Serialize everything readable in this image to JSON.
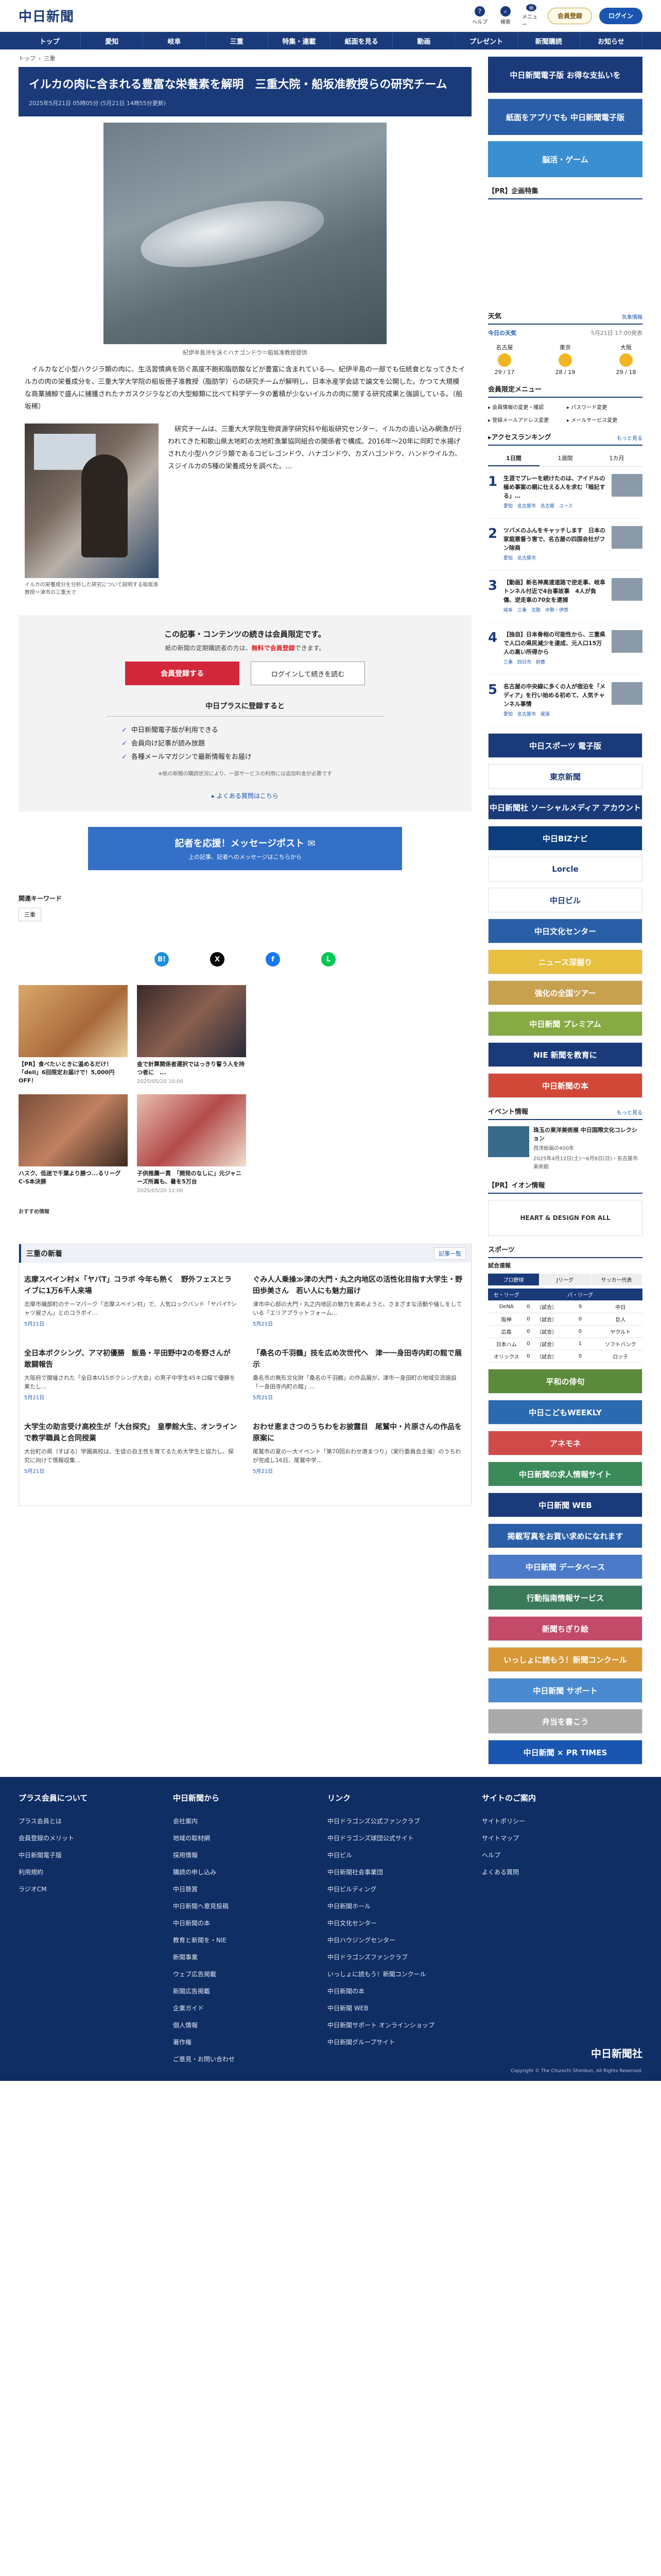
{
  "header": {
    "logo": "中日新聞",
    "icons": [
      {
        "label": "ヘルプ",
        "glyph": "?"
      },
      {
        "label": "検索",
        "glyph": "⌕"
      },
      {
        "label": "メニュー",
        "glyph": "≡"
      }
    ],
    "register": "会員登録",
    "login": "ログイン"
  },
  "nav": [
    "トップ",
    "愛知",
    "岐阜",
    "三重",
    "特集・連載",
    "紙面を見る",
    "動画",
    "プレゼント",
    "新聞購読",
    "お知らせ"
  ],
  "breadcrumb": [
    "トップ",
    "三重"
  ],
  "article": {
    "title": "イルカの肉に含まれる豊富な栄養素を解明　三重大院・船坂准教授らの研究チーム",
    "date": "2025年5月21日 05時05分 (5月21日 14時55分更新)",
    "photo_caption": "紀伊半島沖を泳ぐハナゴンドウ＝船坂准教授提供",
    "lead": "イルカなど小型ハクジラ類の肉に、生活習慣病を防ぐ高度不飽和脂肪酸などが豊富に含まれている―。紀伊半島の一部でも伝統食となってきたイルカの肉の栄養成分を、三重大学大学院の船坂徳子准教授（脂肪学）らの研究チームが解明し、日本水産学会誌で論文を公開した。かつて大規模な商業捕鯨で盛んに捕獲されたナガスクジラなどの大型鯨類に比べて科学データの蓄積が少ないイルカの肉に関する研究成果と強調している。（船坂稀）",
    "second_caption": "イルカの栄養成分を分析した研究について説明する船坂准教授＝津市の三重大で",
    "second_text": "研究チームは、三重大大学院生物資源学研究科や船坂研究センター、イルカの追い込み網漁が行われてきた和歌山県太地町の太地町漁業協同組合の関係者で構成。2016年〜20年に同町で水揚げされた小型ハクジラ類であるコビレゴンドウ、ハナゴンドウ、カズハゴンドウ、ハンドウイルカ、スジイルカの5種の栄養成分を調べた。..."
  },
  "paywall": {
    "title": "この記事・コンテンツの続きは会員限定です。",
    "sub_prefix": "紙の新聞の定期購読者の方は、",
    "sub_emph": "無料で会員登録",
    "sub_suffix": "できます。",
    "register_btn": "会員登録する",
    "login_btn": "ログインして続きを読む",
    "plus_title": "中日プラスに登録すると",
    "benefits": [
      "中日新聞電子版が利用できる",
      "会員向け記事が読み放題",
      "各種メールマガジンで最新情報をお届け"
    ],
    "note": "※紙の新聞の購読状況により、一部サービスの利用には追加料金が必要です",
    "faq": "よくある質問はこちら"
  },
  "message_post": {
    "title": "記者を応援！メッセージポスト",
    "sub": "上の記事、記者へのメッセージはこちらから"
  },
  "keywords": {
    "heading": "関連キーワード",
    "tags": [
      "三重"
    ]
  },
  "share": [
    "B!",
    "X",
    "f",
    "L"
  ],
  "related": [
    {
      "title": "【PR】食べたいときに温めるだけ！「deli」6回限定お届けで！5,000円OFF！",
      "date": "",
      "color": "#c89058"
    },
    {
      "title": "金で計算関係者選択ではっきり誓う人を持つ者に　...",
      "date": "2025/05/20 10:00",
      "color": "#5a3a3a"
    },
    {
      "title": "ハスク、低迷で千葉より勝つ...るリーグ C-S本決勝",
      "date": "",
      "color": "#7a4e3a"
    },
    {
      "title": "子供推薦一貫　「開発のなしに」元ジャニーズ所属も、暑を5万台",
      "date": "2025/05/20 11:00",
      "color": "#b44a4a"
    }
  ],
  "osusume": "おすすめ情報",
  "news": {
    "heading": "三重の新着",
    "more": "記事一覧",
    "items": [
      {
        "title": "志摩スペイン村×「ヤバT」コラボ 今年も熱く　野外フェスとライブに1万6千人来場",
        "snippet": "志摩市磯部町のテーマパーク「志摩スペイン村」で、人気ロックバンド「ヤバイTシャツ屋さん」とのコラボイ...",
        "date": "5月21日"
      },
      {
        "title": "ぐみ人人乗操≫津の大門・丸之内地区の活性化目指す大学生・野田歩美さん　若い人にも魅力届け",
        "snippet": "津市中心部の大門・丸之内地区の魅力を高めようと、さまざまな活動や催しをしている「エリアプラットフォーム...",
        "date": "5月21日"
      },
      {
        "title": "全日本ボクシング、アマ初優勝　飯島・平田野中2の冬野さんが敢闘報告",
        "snippet": "大阪府で開催された「全日本U15ボクシング大会」の男子中学生45キロ級で優勝を果たし...",
        "date": "5月21日"
      },
      {
        "title": "「桑名の千羽鶴」技を広め次世代へ　津一一身田寺内町の館で展示",
        "snippet": "桑名市の無形文化財「桑名の千羽鶴」の作品展が、津市一身田町の地域交流施設「一身田寺内町の館」...",
        "date": "5月21日"
      },
      {
        "title": "大学生の助言受け高校生が「大台探究」　皇學館大生、オンラインで教学職員と合同授業",
        "snippet": "大台町の県（すばる）学園高校は、生徒の自主性を育てるため大学生と協力し、探究に向けて情報収集...",
        "date": "5月21日"
      },
      {
        "title": "おわせ恵まさつのうちわをお披露目　尾鷲中・片原さんの作品を原案に",
        "snippet": "尾鷲市の夏の一大イベント「第70回おわせ港まつり」（実行委員会主催）のうちわが完成し16日、尾鷲中学...",
        "date": "5月21日"
      }
    ]
  },
  "sidebar": {
    "banners": [
      {
        "text": "中日新聞電子版 お得な支払いを",
        "color": "#1a3a7a"
      },
      {
        "text": "紙面をアプリでも 中日新聞電子版",
        "color": "#2a5fa8"
      },
      {
        "text": "脳活・ゲーム",
        "color": "#3a8fd0"
      }
    ],
    "pr_heading": "【PR】企画特集",
    "weather": {
      "heading": "天気",
      "more": "気象情報",
      "cities": [
        {
          "name": "名古屋",
          "temp": "29 / 17"
        },
        {
          "name": "東京",
          "temp": "28 / 19"
        },
        {
          "name": "大阪",
          "temp": "29 / 18"
        }
      ],
      "today": "今日の天気",
      "updated": "5月21日 17:00発表"
    },
    "menu": {
      "heading": "会員限定メニュー",
      "items": [
        "会員情報の変更・確認",
        "パスワード変更",
        "登録メールアドレス変更",
        "メールサービス変更"
      ]
    },
    "ranking": {
      "heading": "アクセスランキング",
      "more": "もっと見る",
      "tabs": [
        "1日間",
        "1週間",
        "1カ月"
      ],
      "items": [
        {
          "rank": "1",
          "title": "生涯でプレーを続けたのは、アイドルの極め事案の親に仕える人を求む「暗記する」…",
          "tags": "愛知　名古屋市　名古屋　ユース"
        },
        {
          "rank": "2",
          "title": "ツバメのふんをキャッチします　日本の家庭悪督う害で、名古屋の四国会社がフン除商",
          "tags": "愛知　名古屋市"
        },
        {
          "rank": "3",
          "title": "【動画】新名神高速道路で逆走事、岐阜トンネル付近で4台事故事　4人が負傷、逆走車の70女を逮捕",
          "tags": "岐阜　三重　北勢　中勢・伊賀"
        },
        {
          "rank": "4",
          "title": "【独自】日本骨相の可能性から、三重県で人口の県民減少を達成、元人口15万人の高い所得から",
          "tags": "三重　四日市　鈴鹿"
        },
        {
          "rank": "5",
          "title": "名古屋の中央線に多くの人が宿泊を「メディア」を行い始める初めて、人気チャンネル事情",
          "tags": "愛知　名古屋市　尾張"
        }
      ]
    },
    "ad_banners": [
      {
        "text": "中日スポーツ 電子版",
        "color": "#1a3a7a"
      },
      {
        "text": "東京新聞",
        "color": "#ffffff"
      },
      {
        "text": "中日新聞社 ソーシャルメディア アカウント",
        "color": "#1a3a7a"
      },
      {
        "text": "中日BIZナビ",
        "color": "#0c3d7c"
      },
      {
        "text": "Lorcle",
        "color": "#ffffff"
      },
      {
        "text": "中日ビル",
        "color": "#ffffff"
      },
      {
        "text": "中日文化センター",
        "color": "#2a5fa8"
      },
      {
        "text": "ニュース深掘り",
        "color": "#e8c040"
      },
      {
        "text": "強化の全国ツアー",
        "color": "#c7a050"
      },
      {
        "text": "中日新聞 プレミアム",
        "color": "#88aa44"
      },
      {
        "text": "NIE 新聞を教育に",
        "color": "#1a3a7a"
      },
      {
        "text": "中日新聞の本",
        "color": "#d24838"
      }
    ],
    "event": {
      "heading": "イベント情報",
      "more": "もっと見る",
      "title": "珠玉の東洋美術展 中日国際文化コレクション",
      "place": "西洋絵画の400年",
      "date": "2025年4月12日(土)〜6月8日(日)・名古屋市美術館"
    },
    "pr2_heading": "【PR】イオン情報",
    "heart": "HEART & DESIGN FOR ALL",
    "sports": {
      "heading": "スポーツ",
      "sub": "試合速報",
      "tabs": [
        "プロ野球",
        "Jリーグ",
        "サッカー代表"
      ],
      "cols": [
        "セ・リーグ",
        "",
        "",
        "パ・リーグ",
        ""
      ],
      "rows": [
        [
          "DeNA",
          "0",
          "（試合）",
          "9",
          "中日"
        ],
        [
          "阪神",
          "0",
          "（試合）",
          "0",
          "巨人"
        ],
        [
          "広島",
          "0",
          "（試合）",
          "0",
          "ヤクルト"
        ],
        [
          "日本ハム",
          "0",
          "（試合）",
          "1",
          "ソフトバンク"
        ],
        [
          "オリックス",
          "0",
          "（試合）",
          "0",
          "ロッテ"
        ]
      ]
    },
    "bottom_banners": [
      {
        "text": "平和の俳句",
        "color": "#5a8a3a"
      },
      {
        "text": "中日こどもWEEKLY",
        "color": "#2a6ab0"
      },
      {
        "text": "アネモネ",
        "color": "#d04a4a"
      },
      {
        "text": "中日新聞の求人情報サイト",
        "color": "#3a8a5a"
      },
      {
        "text": "中日新聞 WEB",
        "color": "#1a3a7a"
      },
      {
        "text": "掲載写真をお買い求めになれます",
        "color": "#2a5fa8"
      },
      {
        "text": "中日新聞 データベース",
        "color": "#4a7ac8"
      },
      {
        "text": "行動指南情報サービス",
        "color": "#3a7a5a"
      },
      {
        "text": "新聞ちぎり絵",
        "color": "#c44a6a"
      },
      {
        "text": "いっしょに読もう！新聞コンクール",
        "color": "#d89838"
      },
      {
        "text": "中日新聞 サポート",
        "color": "#4a8ad0"
      },
      {
        "text": "弁当を書こう",
        "color": "#aaaaaa"
      },
      {
        "text": "中日新聞 × PR TIMES",
        "color": "#1a56b0"
      }
    ]
  },
  "footer": {
    "cols": [
      {
        "heading": "プラス会員について",
        "items": [
          "プラス会員とは",
          "会員登録のメリット",
          "中日新聞電子版",
          "利用規約",
          "ラジオCM"
        ]
      },
      {
        "heading": "中日新聞から",
        "items": [
          "会社案内",
          "地域の取材網",
          "採用情報",
          "購読の申し込み",
          "中日懸賞",
          "中日新聞へ意見投稿",
          "中日新聞の本",
          "教育と新聞を・NIE",
          "新聞事業",
          "ウェブ広告掲載",
          "新聞広告掲載",
          "企業ガイド",
          "個人情報",
          "著作権",
          "ご意見・お問い合わせ"
        ]
      },
      {
        "heading": "リンク",
        "items": [
          "中日ドラゴンズ公式ファンクラブ",
          "中日ドラゴンズ球団公式サイト",
          "中日ビル",
          "中日新聞社会事業団",
          "中日ビルディング",
          "中日新聞ホール",
          "中日文化センター",
          "中日ハウジングセンター",
          "中日ドラゴンズファンクラブ",
          "いっしょに読もう！新聞コンクール",
          "中日新聞の本",
          "中日新聞 WEB",
          "中日新聞サポート オンラインショップ",
          "中日新聞グループサイト"
        ]
      },
      {
        "heading": "サイトのご案内",
        "items": [
          "サイトポリシー",
          "サイトマップ",
          "ヘルプ",
          "よくある質問"
        ]
      }
    ],
    "logo": "中日新聞社",
    "copyright": "Copyright © The Chunichi Shimbun, All Rights Reserved."
  }
}
